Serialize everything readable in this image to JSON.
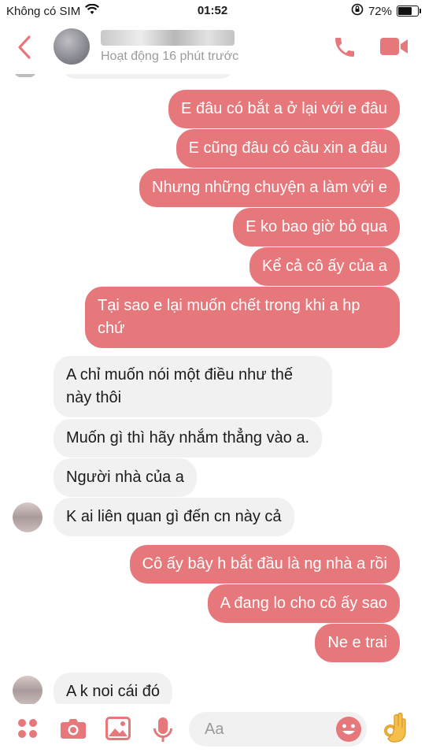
{
  "status_bar": {
    "carrier": "Không có SIM",
    "time": "01:52",
    "battery": "72%"
  },
  "header": {
    "active_status": "Hoạt động 16 phút trước"
  },
  "composer": {
    "placeholder": "Aa"
  },
  "colors": {
    "accent": "#e6787c",
    "incoming_bubble": "#f1f1f1"
  },
  "messages": [
    {
      "from": "me",
      "text": "E đâu có bắt a ở lại với e đâu"
    },
    {
      "from": "me",
      "text": "E cũng đâu có cầu xin a đâu"
    },
    {
      "from": "me",
      "text": "Nhưng những chuyện a làm với e"
    },
    {
      "from": "me",
      "text": "E ko bao giờ bỏ qua"
    },
    {
      "from": "me",
      "text": "Kể cả cô ấy của a"
    },
    {
      "from": "me",
      "text": "Tại sao e lại muốn chết trong khi a hp chứ"
    },
    {
      "from": "them",
      "text": "A chỉ muốn nói một điều như thế này thôi"
    },
    {
      "from": "them",
      "text": "Muốn gì thì hãy nhắm thẳng vào a."
    },
    {
      "from": "them",
      "text": "Người nhà của a"
    },
    {
      "from": "them",
      "text": "K ai liên quan gì đến cn này cả"
    },
    {
      "from": "me",
      "text": "Cô ấy bây h bắt đầu là ng nhà a rồi"
    },
    {
      "from": "me",
      "text": "A đang lo cho cô ấy sao"
    },
    {
      "from": "me",
      "text": "Ne e trai"
    },
    {
      "from": "them",
      "text": "A k noi cái đó"
    }
  ]
}
